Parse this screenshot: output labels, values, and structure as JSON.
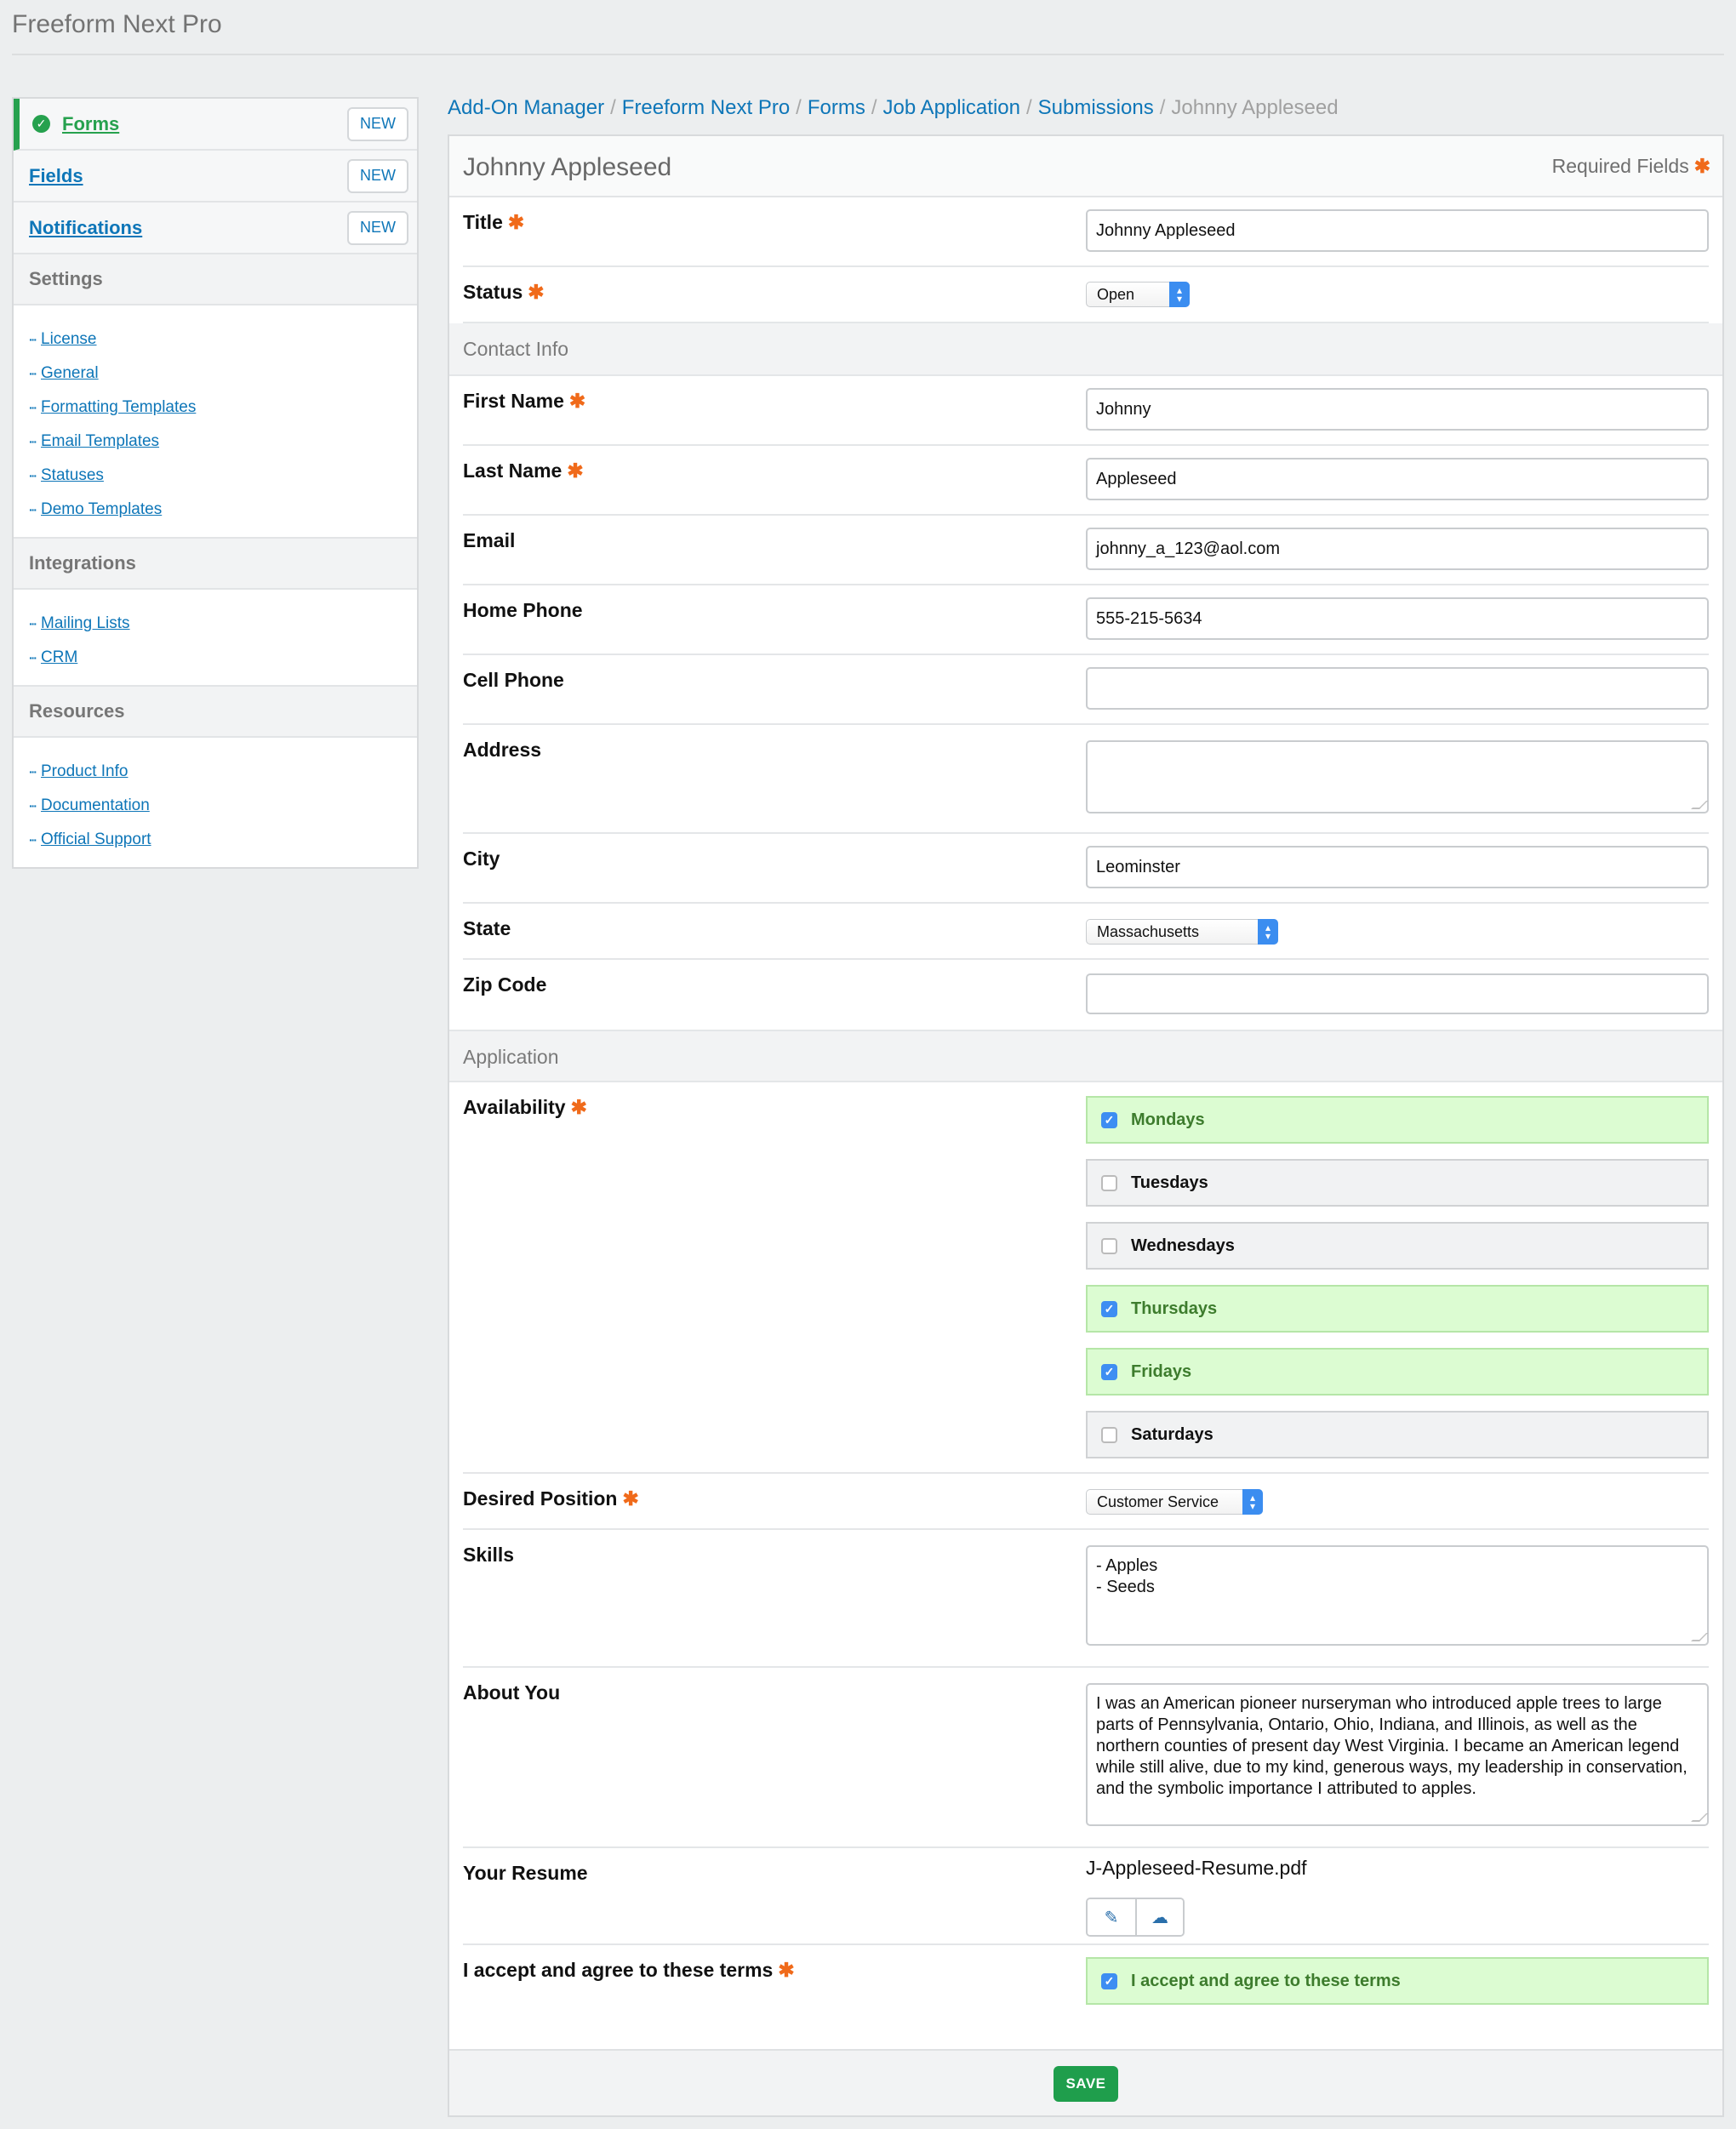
{
  "app": {
    "title": "Freeform Next Pro"
  },
  "sidebar": {
    "nav": [
      {
        "label": "Forms",
        "button": "NEW"
      },
      {
        "label": "Fields",
        "button": "NEW"
      },
      {
        "label": "Notifications",
        "button": "NEW"
      }
    ],
    "settings": {
      "title": "Settings",
      "items": [
        "License",
        "General",
        "Formatting Templates",
        "Email Templates",
        "Statuses",
        "Demo Templates"
      ]
    },
    "integrations": {
      "title": "Integrations",
      "items": [
        "Mailing Lists",
        "CRM"
      ]
    },
    "resources": {
      "title": "Resources",
      "items": [
        "Product Info",
        "Documentation",
        "Official Support"
      ]
    }
  },
  "breadcrumb": [
    "Add-On Manager",
    "Freeform Next Pro",
    "Forms",
    "Job Application",
    "Submissions",
    "Johnny Appleseed"
  ],
  "form": {
    "title": "Johnny Appleseed",
    "required_label": "Required Fields",
    "required_marker": "✱",
    "fields": {
      "title": {
        "label": "Title",
        "value": "Johnny Appleseed"
      },
      "status": {
        "label": "Status",
        "value": "Open"
      },
      "contact_group": "Contact Info",
      "first_name": {
        "label": "First Name",
        "value": "Johnny"
      },
      "last_name": {
        "label": "Last Name",
        "value": "Appleseed"
      },
      "email": {
        "label": "Email",
        "value": "johnny_a_123@aol.com"
      },
      "home_phone": {
        "label": "Home Phone",
        "value": "555-215-5634"
      },
      "cell_phone": {
        "label": "Cell Phone",
        "value": ""
      },
      "address": {
        "label": "Address",
        "value": ""
      },
      "city": {
        "label": "City",
        "value": "Leominster"
      },
      "state": {
        "label": "State",
        "value": "Massachusetts"
      },
      "zip": {
        "label": "Zip Code",
        "value": ""
      },
      "application_group": "Application",
      "availability": {
        "label": "Availability",
        "options": [
          {
            "label": "Mondays",
            "checked": true
          },
          {
            "label": "Tuesdays",
            "checked": false
          },
          {
            "label": "Wednesdays",
            "checked": false
          },
          {
            "label": "Thursdays",
            "checked": true
          },
          {
            "label": "Fridays",
            "checked": true
          },
          {
            "label": "Saturdays",
            "checked": false
          }
        ]
      },
      "position": {
        "label": "Desired Position",
        "value": "Customer Service"
      },
      "skills": {
        "label": "Skills",
        "value": "- Apples\n- Seeds"
      },
      "about": {
        "label": "About You",
        "value": "I was an American pioneer nurseryman who introduced apple trees to large parts of Pennsylvania, Ontario, Ohio, Indiana, and Illinois, as well as the northern counties of present day West Virginia. I became an American legend while still alive, due to my kind, generous ways, my leadership in conservation, and the symbolic importance I attributed to apples."
      },
      "resume": {
        "label": "Your Resume",
        "filename": "J-Appleseed-Resume.pdf"
      },
      "terms": {
        "label": "I accept and agree to these terms",
        "option": "I accept and agree to these terms",
        "checked": true
      }
    },
    "save_label": "SAVE"
  },
  "icons": {
    "active": "check-circle-icon",
    "edit": "pencil-icon",
    "download": "cloud-download-icon"
  },
  "colors": {
    "accent": "#0e76b8",
    "success": "#26a14e",
    "required": "#f06a1a",
    "checked_bg": "#dcfcd2"
  }
}
